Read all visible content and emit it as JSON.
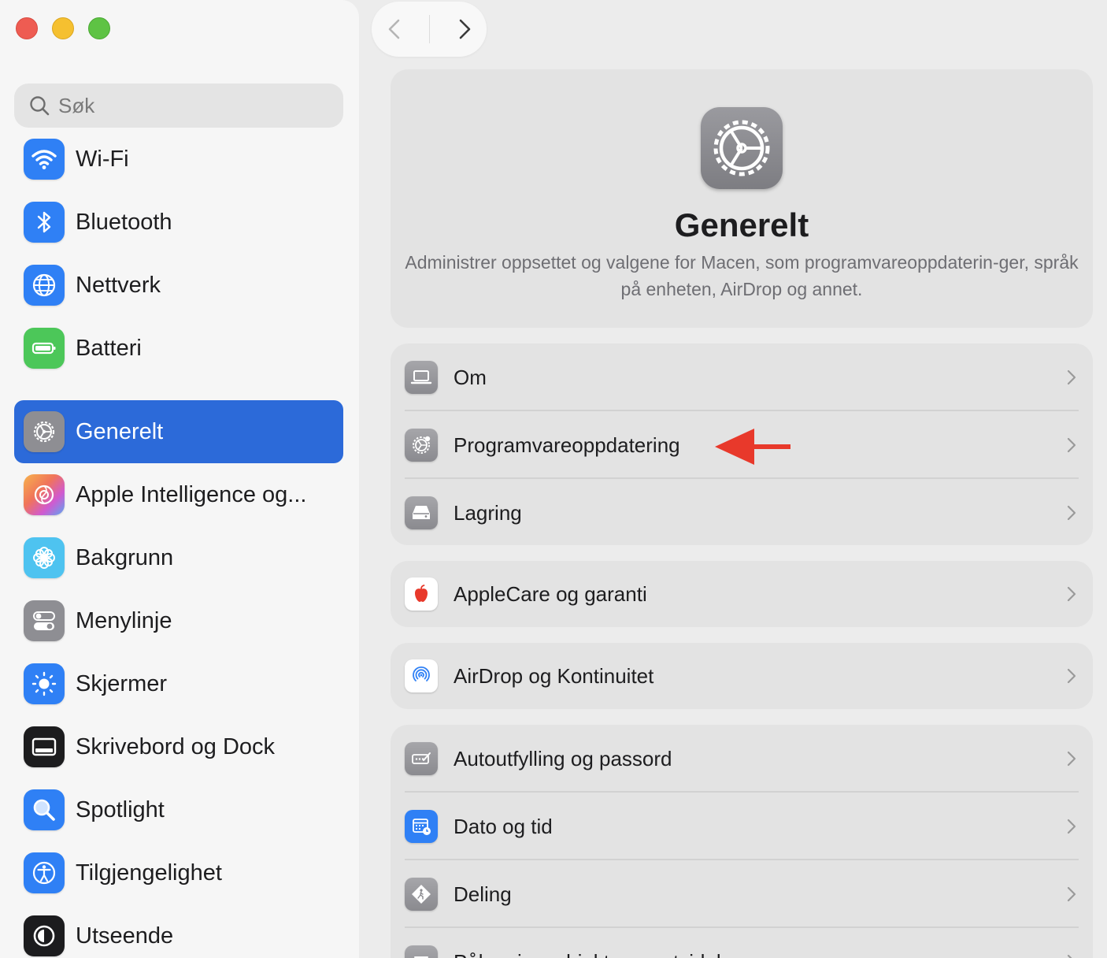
{
  "window": {
    "traffic_lights": [
      "close",
      "minimize",
      "zoom"
    ]
  },
  "search": {
    "placeholder": "Søk"
  },
  "sidebar": {
    "items": [
      {
        "label": "Wi-Fi",
        "icon": "wifi-icon",
        "color": "#2f80f5"
      },
      {
        "label": "Bluetooth",
        "icon": "bluetooth-icon",
        "color": "#2f80f5"
      },
      {
        "label": "Nettverk",
        "icon": "globe-icon",
        "color": "#2f80f5"
      },
      {
        "label": "Batteri",
        "icon": "battery-icon",
        "color": "#4cc759"
      },
      {
        "label": "Generelt",
        "icon": "gear-icon",
        "color": "#8e8e93",
        "selected": true
      },
      {
        "label": "Apple Intelligence og...",
        "icon": "apple-intelligence-icon",
        "color": "#f08a5d"
      },
      {
        "label": "Bakgrunn",
        "icon": "flower-icon",
        "color": "#4ec3f0"
      },
      {
        "label": "Menylinje",
        "icon": "toggles-icon",
        "color": "#8e8e93"
      },
      {
        "label": "Skjermer",
        "icon": "sun-icon",
        "color": "#2f80f5"
      },
      {
        "label": "Skrivebord og Dock",
        "icon": "dock-icon",
        "color": "#1c1c1e"
      },
      {
        "label": "Spotlight",
        "icon": "magnifier-icon",
        "color": "#2f80f5"
      },
      {
        "label": "Tilgjengelighet",
        "icon": "accessibility-icon",
        "color": "#2f80f5"
      },
      {
        "label": "Utseende",
        "icon": "appearance-icon",
        "color": "#1c1c1e"
      }
    ]
  },
  "header": {
    "title": "Generelt",
    "description": "Administrer oppsettet og valgene for Macen, som programvareoppdaterin-ger, språk på enheten, AirDrop og annet."
  },
  "groups": [
    {
      "rows": [
        {
          "label": "Om",
          "icon": "laptop-icon"
        },
        {
          "label": "Programvareoppdatering",
          "icon": "software-update-gear-icon",
          "highlighted_by_arrow": true
        },
        {
          "label": "Lagring",
          "icon": "drive-icon"
        }
      ]
    },
    {
      "rows": [
        {
          "label": "AppleCare og garanti",
          "icon": "apple-logo-icon"
        }
      ]
    },
    {
      "rows": [
        {
          "label": "AirDrop og Kontinuitet",
          "icon": "airdrop-icon"
        }
      ]
    },
    {
      "rows": [
        {
          "label": "Autoutfylling og passord",
          "icon": "autofill-icon"
        },
        {
          "label": "Dato og tid",
          "icon": "calendar-clock-icon"
        },
        {
          "label": "Deling",
          "icon": "sharing-icon"
        },
        {
          "label": "Påloggingsobjekter og utvidelser",
          "icon": "list-icon"
        }
      ]
    }
  ],
  "colors": {
    "accent": "#2c6ad9",
    "arrow": "#e8392b"
  }
}
